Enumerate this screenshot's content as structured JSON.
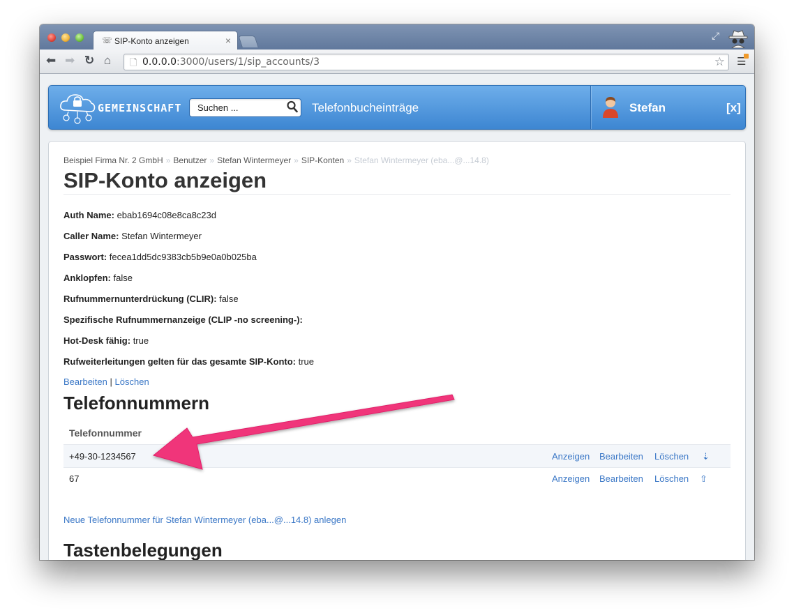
{
  "browser": {
    "tab_title": "SIP-Konto anzeigen",
    "tab_close": "×",
    "url_host": "0.0.0.0",
    "url_path": ":3000/users/1/sip_accounts/3"
  },
  "header": {
    "brand": "GEMEINSCHAFT",
    "search_placeholder": "Suchen ...",
    "phonebook_link": "Telefonbucheinträge",
    "user_name": "Stefan",
    "logout": "[x]"
  },
  "breadcrumb": {
    "items": [
      "Beispiel Firma Nr. 2 GmbH",
      "Benutzer",
      "Stefan Wintermeyer",
      "SIP-Konten"
    ],
    "current": "Stefan Wintermeyer (eba...@...14.8)",
    "separator": "»"
  },
  "page": {
    "title": "SIP-Konto anzeigen",
    "fields": [
      {
        "label": "Auth Name:",
        "value": "ebab1694c08e8ca8c23d"
      },
      {
        "label": "Caller Name:",
        "value": "Stefan Wintermeyer"
      },
      {
        "label": "Passwort:",
        "value": "fecea1dd5dc9383cb5b9e0a0b025ba"
      },
      {
        "label": "Anklopfen:",
        "value": "false"
      },
      {
        "label": "Rufnummernunterdrückung (CLIR):",
        "value": "false"
      },
      {
        "label": "Spezifische Rufnummernanzeige (CLIP -no screening-):",
        "value": ""
      },
      {
        "label": "Hot-Desk fähig:",
        "value": "true"
      },
      {
        "label": "Rufweiterleitungen gelten für das gesamte SIP-Konto:",
        "value": "true"
      }
    ],
    "edit_link": "Bearbeiten",
    "action_separator": "|",
    "delete_link": "Löschen"
  },
  "phone_numbers": {
    "heading": "Telefonnummern",
    "column_header": "Telefonnummer",
    "rows": [
      {
        "number": "+49-30-1234567",
        "show": "Anzeigen",
        "edit": "Bearbeiten",
        "delete": "Löschen",
        "move": "⇣"
      },
      {
        "number": "67",
        "show": "Anzeigen",
        "edit": "Bearbeiten",
        "delete": "Löschen",
        "move": "⇧"
      }
    ],
    "new_link": "Neue Telefonnummer für Stefan Wintermeyer (eba...@...14.8) anlegen"
  },
  "softkeys": {
    "heading": "Tastenbelegungen"
  },
  "colors": {
    "link": "#3a77c6",
    "appbar_top": "#6eaeea",
    "appbar_bottom": "#3d86d2",
    "annotation_arrow": "#f0357a"
  },
  "icons": {
    "tab": "phone-icon",
    "incognito": "incognito-icon",
    "search": "magnifier-icon",
    "user": "user-avatar-icon"
  }
}
